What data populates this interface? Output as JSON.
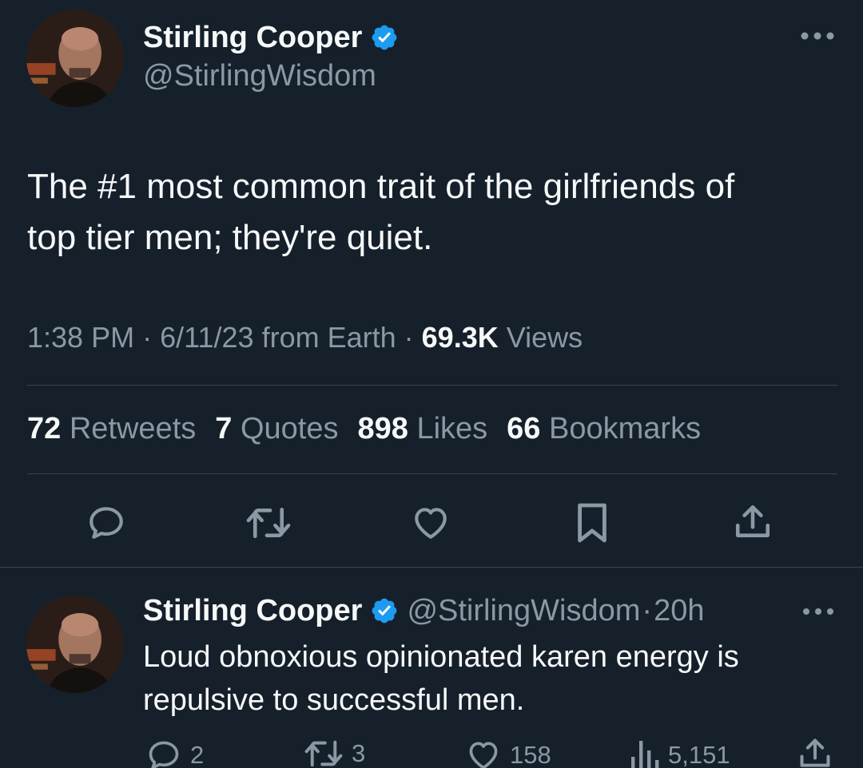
{
  "tweet": {
    "author_name": "Stirling Cooper",
    "author_handle": "@StirlingWisdom",
    "text_line1": "The #1 most common trait of the girlfriends of",
    "text_line2": "top tier men; they're quiet.",
    "time": "1:38 PM",
    "date": "6/11/23",
    "source": "from Earth",
    "views_count": "69.3K",
    "views_label": "Views",
    "sep": "·"
  },
  "stats": [
    {
      "count": "72",
      "label": "Retweets"
    },
    {
      "count": "7",
      "label": "Quotes"
    },
    {
      "count": "898",
      "label": "Likes"
    },
    {
      "count": "66",
      "label": "Bookmarks"
    }
  ],
  "reply": {
    "author_name": "Stirling Cooper",
    "author_handle": "@StirlingWisdom",
    "age": "20h",
    "sep": "·",
    "text_line1": "Loud obnoxious opinionated karen energy is",
    "text_line2": "repulsive to successful men.",
    "replies": "2",
    "retweets": "3",
    "likes": "158",
    "views": "5,151"
  },
  "icons": {
    "more": "more-icon",
    "verified": "verified-badge-icon",
    "reply": "reply-icon",
    "retweet": "retweet-icon",
    "like": "heart-icon",
    "bookmark": "bookmark-icon",
    "share": "share-icon",
    "views": "analytics-icon"
  },
  "colors": {
    "background": "#15202b",
    "text": "#f7f9f9",
    "muted": "#8b98a5",
    "verified": "#1d9bf0",
    "divider": "#38444d"
  }
}
